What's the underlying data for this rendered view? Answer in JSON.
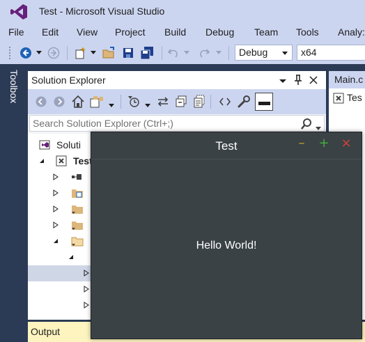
{
  "window": {
    "title": "Test - Microsoft Visual Studio"
  },
  "menu": [
    "File",
    "Edit",
    "View",
    "Project",
    "Build",
    "Debug",
    "Team",
    "Tools",
    "Analy:"
  ],
  "toolbar": {
    "config": "Debug",
    "platform": "x64"
  },
  "toolbox": {
    "label": "Toolbox"
  },
  "solution_explorer": {
    "title": "Solution Explorer",
    "search_placeholder": "Search Solution Explorer (Ctrl+;)",
    "items": [
      {
        "label": "Soluti"
      },
      {
        "label": "Test"
      }
    ]
  },
  "document": {
    "tab": "Main.c",
    "file_label": "Tes"
  },
  "output": {
    "label": "Output"
  },
  "app_window": {
    "title": "Test",
    "minimize": "–",
    "maximize": "+",
    "close": "×",
    "body_text": "Hello World!"
  },
  "colors": {
    "accent": "#007acc",
    "chrome": "#ccd5f0",
    "dark": "#2b3a55"
  }
}
